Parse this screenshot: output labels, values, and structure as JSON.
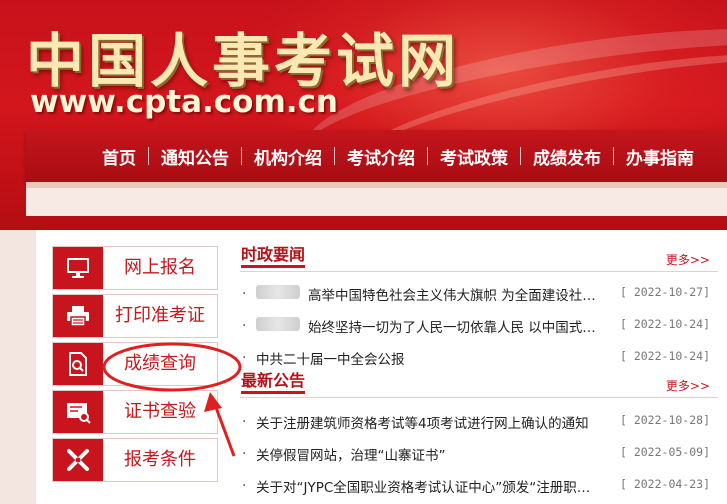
{
  "header": {
    "site_title": "中国人事考试网",
    "site_url": "www.cpta.com.cn"
  },
  "nav": {
    "items": [
      "首页",
      "通知公告",
      "机构介绍",
      "考试介绍",
      "考试政策",
      "成绩发布",
      "办事指南"
    ]
  },
  "quick_links": [
    {
      "label": "网上报名",
      "icon": "monitor-icon"
    },
    {
      "label": "打印准考证",
      "icon": "printer-icon"
    },
    {
      "label": "成绩查询",
      "icon": "document-search-icon"
    },
    {
      "label": "证书查验",
      "icon": "certificate-check-icon"
    },
    {
      "label": "报考条件",
      "icon": "tools-icon"
    }
  ],
  "news_politics": {
    "title": "时政要闻",
    "more": "更多>>",
    "items": [
      {
        "title": "高举中国特色社会主义伟大旗帜 为全面建设社…",
        "date": "[ 2022-10-27]",
        "blurred_prefix": true
      },
      {
        "title": "始终坚持一切为了人民一切依靠人民 以中国式…",
        "date": "[ 2022-10-24]",
        "blurred_prefix": true
      },
      {
        "title": "中共二十届一中全会公报",
        "date": "[ 2022-10-24]",
        "blurred_prefix": false
      }
    ]
  },
  "news_notices": {
    "title": "最新公告",
    "more": "更多>>",
    "items": [
      {
        "title": "关于注册建筑师资格考试等4项考试进行网上确认的通知",
        "date": "[ 2022-10-28]"
      },
      {
        "title": "关停假冒网站，治理“山寨证书”",
        "date": "[ 2022-05-09]"
      },
      {
        "title": "关于对“JYPC全国职业资格考试认证中心”颁发“注册职…",
        "date": "[ 2022-04-23]"
      }
    ]
  },
  "colors": {
    "brand_red": "#c8151d",
    "title_gold": "#fbe8b4",
    "annotation_red": "#e02020"
  }
}
